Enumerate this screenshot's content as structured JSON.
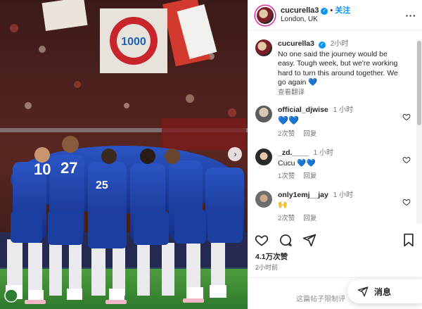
{
  "header": {
    "username": "cucurella3",
    "separator": "•",
    "follow_label": "关注",
    "location": "London, UK",
    "more_label": "···"
  },
  "caption": {
    "username": "cucurella3",
    "time": "2小时",
    "text": "No one said the journey would be easy. Tough week, but we're working hard to turn this around together. We go again 💙",
    "translate_label": "查看翻译"
  },
  "comments": [
    {
      "username": "official_djwise",
      "time": "1 小时",
      "text": "💙💙",
      "likes": "2次赞",
      "reply": "回复"
    },
    {
      "username": "_zd.____",
      "time": "1 小时",
      "text": "Cucu 💙💙",
      "likes": "1次赞",
      "reply": "回复"
    },
    {
      "username": "only1emj__jay",
      "time": "1 小时",
      "text": "🙌",
      "likes": "2次赞",
      "reply": "回复"
    }
  ],
  "stats": {
    "likes": "4.1万次赞",
    "date": "2小时前"
  },
  "footer": {
    "restricted_text": "这篇帖子限制评",
    "message_label": "消息"
  },
  "media": {
    "banner_text": "1000",
    "jersey_numbers": [
      "10",
      "27",
      "25"
    ]
  },
  "colors": {
    "accent": "#0095f6",
    "jersey_blue": "#1b3fa0",
    "pitch_green": "#3f8f3a"
  }
}
